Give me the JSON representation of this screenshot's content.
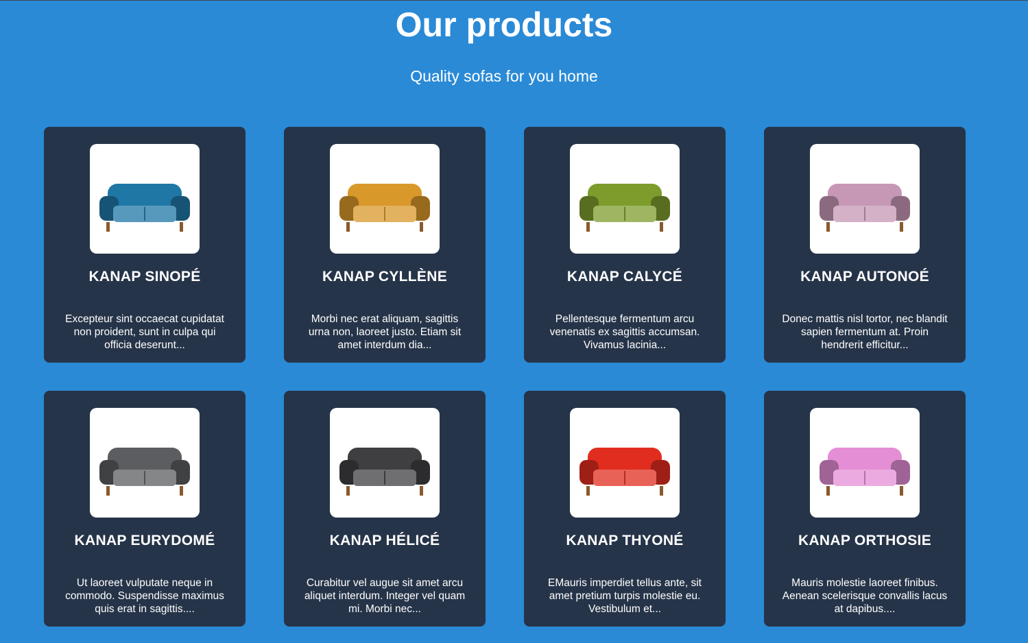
{
  "header": {
    "title": "Our products",
    "subtitle": "Quality sofas for you home"
  },
  "products": [
    {
      "name": "KANAP SINOPÉ",
      "description": "Excepteur sint occaecat cupidatat non proident, sunt in culpa qui officia deserunt...",
      "sofa_color": "#1f77a6"
    },
    {
      "name": "KANAP CYLLÈNE",
      "description": "Morbi nec erat aliquam, sagittis urna non, laoreet justo. Etiam sit amet interdum dia...",
      "sofa_color": "#d9982a"
    },
    {
      "name": "KANAP CALYCÉ",
      "description": "Pellentesque fermentum arcu venenatis ex sagittis accumsan. Vivamus lacinia...",
      "sofa_color": "#7e9c2c"
    },
    {
      "name": "KANAP AUTONOÉ",
      "description": "Donec mattis nisl tortor, nec blandit sapien fermentum at. Proin hendrerit efficitur...",
      "sofa_color": "#c797b6"
    },
    {
      "name": "KANAP EURYDOMÉ",
      "description": "Ut laoreet vulputate neque in commodo. Suspendisse maximus quis erat in sagittis....",
      "sofa_color": "#5c5d60"
    },
    {
      "name": "KANAP HÉLICÉ",
      "description": "Curabitur vel augue sit amet arcu aliquet interdum. Integer vel quam mi. Morbi nec...",
      "sofa_color": "#3f3f42"
    },
    {
      "name": "KANAP THYONÉ",
      "description": "EMauris imperdiet tellus ante, sit amet pretium turpis molestie eu. Vestibulum et...",
      "sofa_color": "#e12d1f"
    },
    {
      "name": "KANAP ORTHOSIE",
      "description": "Mauris molestie laoreet finibus. Aenean scelerisque convallis lacus at dapibus....",
      "sofa_color": "#e48ed6"
    }
  ]
}
